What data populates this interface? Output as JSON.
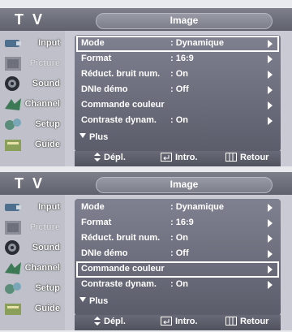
{
  "screens": [
    {
      "tv_label": "T V",
      "menu_title": "Image",
      "sidebar": [
        "Input",
        "Picture",
        "Sound",
        "Channel",
        "Setup",
        "Guide"
      ],
      "rows": [
        {
          "label": "Mode",
          "value": ": Dynamique"
        },
        {
          "label": "Format",
          "value": ": 16:9"
        },
        {
          "label": "Réduct. bruit num.",
          "value": ": On"
        },
        {
          "label": "DNIe démo",
          "value": ": Off"
        },
        {
          "label": "Commande couleur",
          "value": ""
        },
        {
          "label": "Contraste dynam.",
          "value": ": On"
        }
      ],
      "selected_row": "Mode",
      "more_label": "Plus",
      "footer": {
        "move": "Dépl.",
        "enter": "Intro.",
        "back": "Retour"
      }
    },
    {
      "tv_label": "T V",
      "menu_title": "Image",
      "sidebar": [
        "Input",
        "Picture",
        "Sound",
        "Channel",
        "Setup",
        "Guide"
      ],
      "rows": [
        {
          "label": "Mode",
          "value": ": Dynamique"
        },
        {
          "label": "Format",
          "value": ": 16:9"
        },
        {
          "label": "Réduct. bruit num.",
          "value": ": On"
        },
        {
          "label": "DNIe démo",
          "value": ": Off"
        },
        {
          "label": "Commande couleur",
          "value": ""
        },
        {
          "label": "Contraste dynam.",
          "value": ": On"
        }
      ],
      "selected_row": "Commande couleur",
      "more_label": "Plus",
      "footer": {
        "move": "Dépl.",
        "enter": "Intro.",
        "back": "Retour"
      }
    }
  ],
  "colors": {
    "highlight_border": "#ffffff",
    "panel": "#6d6f7d"
  },
  "icons": [
    "input-icon",
    "picture-icon",
    "sound-icon",
    "channel-icon",
    "setup-icon",
    "guide-icon",
    "updown-arrow-icon",
    "enter-icon",
    "return-icon",
    "right-arrow-icon",
    "down-arrow-icon"
  ]
}
